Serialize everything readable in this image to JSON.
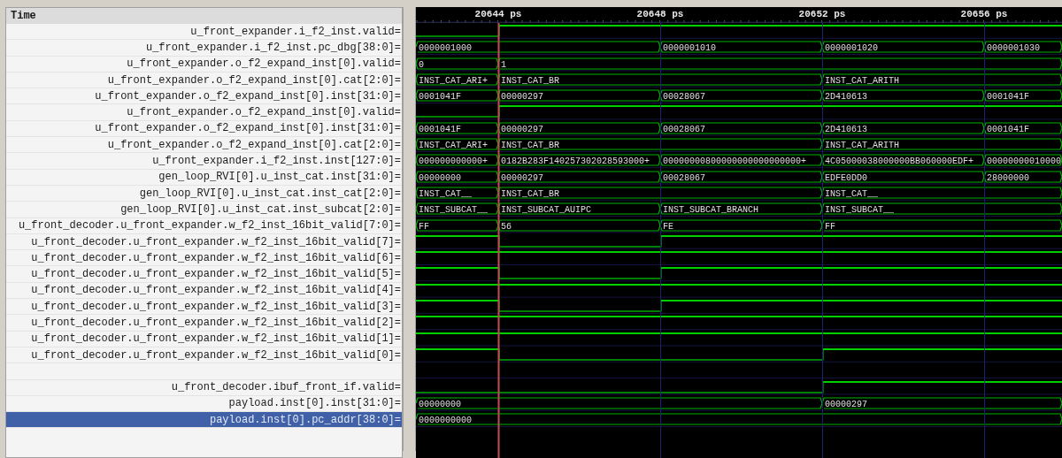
{
  "time_header": "Time",
  "ticks": [
    {
      "label": "20644 ps",
      "cursor": true
    },
    {
      "label": "20648 ps",
      "cursor": false
    },
    {
      "label": "20652 ps",
      "cursor": false
    },
    {
      "label": "20656 ps",
      "cursor": false
    }
  ],
  "signals": [
    {
      "name": "u_front_expander.i_f2_inst.valid=",
      "selected": false,
      "kind": "bit",
      "high": [
        false,
        true,
        true,
        true,
        true
      ]
    },
    {
      "name": "u_front_expander.i_f2_inst.pc_dbg[38:0]=",
      "selected": false,
      "kind": "bus",
      "intervals": [
        {
          "value": "0000001000",
          "hold": false
        },
        {
          "hold": true
        },
        {
          "value": "0000001010",
          "hold": false
        },
        {
          "value": "0000001020",
          "hold": false
        },
        {
          "value": "0000001030",
          "hold": false
        }
      ]
    },
    {
      "name": "u_front_expander.o_f2_expand_inst[0].valid=",
      "selected": false,
      "kind": "bus",
      "intervals": [
        {
          "value": "0",
          "hold": false
        },
        {
          "value": "1",
          "hold": false
        },
        {
          "hold": true
        },
        {
          "hold": true
        },
        {
          "hold": true
        }
      ]
    },
    {
      "name": "u_front_expander.o_f2_expand_inst[0].cat[2:0]=",
      "selected": false,
      "kind": "bus",
      "intervals": [
        {
          "value": "INST_CAT_ARI+",
          "hold": false
        },
        {
          "value": "INST_CAT_BR",
          "hold": false
        },
        {
          "hold": true
        },
        {
          "value": "INST_CAT_ARITH",
          "hold": false
        },
        {
          "hold": true
        }
      ]
    },
    {
      "name": "u_front_expander.o_f2_expand_inst[0].inst[31:0]=",
      "selected": false,
      "kind": "bus",
      "intervals": [
        {
          "value": "0001041F",
          "hold": false
        },
        {
          "value": "00000297",
          "hold": false
        },
        {
          "value": "00028067",
          "hold": false
        },
        {
          "value": "2D410613",
          "hold": false
        },
        {
          "value": "0001041F",
          "hold": false
        }
      ]
    },
    {
      "name": "u_front_expander.o_f2_expand_inst[0].valid=",
      "selected": false,
      "kind": "bit",
      "high": [
        false,
        true,
        true,
        true,
        true
      ]
    },
    {
      "name": "u_front_expander.o_f2_expand_inst[0].inst[31:0]=",
      "selected": false,
      "kind": "bus",
      "intervals": [
        {
          "value": "0001041F",
          "hold": false
        },
        {
          "value": "00000297",
          "hold": false
        },
        {
          "value": "00028067",
          "hold": false
        },
        {
          "value": "2D410613",
          "hold": false
        },
        {
          "value": "0001041F",
          "hold": false
        }
      ]
    },
    {
      "name": "u_front_expander.o_f2_expand_inst[0].cat[2:0]=",
      "selected": false,
      "kind": "bus",
      "intervals": [
        {
          "value": "INST_CAT_ARI+",
          "hold": false
        },
        {
          "value": "INST_CAT_BR",
          "hold": false
        },
        {
          "hold": true
        },
        {
          "value": "INST_CAT_ARITH",
          "hold": false
        },
        {
          "hold": true
        }
      ]
    },
    {
      "name": "u_front_expander.i_f2_inst.inst[127:0]=",
      "selected": false,
      "kind": "bus",
      "intervals": [
        {
          "value": "000000000000+",
          "hold": false
        },
        {
          "value": "0182B283F140257302028593000+",
          "hold": false
        },
        {
          "value": "00000000800000000000000000+",
          "hold": false
        },
        {
          "value": "4C05000038000000BB060000EDF+",
          "hold": false
        },
        {
          "value": "00000000010000",
          "hold": false
        }
      ]
    },
    {
      "name": "gen_loop_RVI[0].u_inst_cat.inst[31:0]=",
      "selected": false,
      "kind": "bus",
      "intervals": [
        {
          "value": "00000000",
          "hold": false
        },
        {
          "value": "00000297",
          "hold": false
        },
        {
          "value": "00028067",
          "hold": false
        },
        {
          "value": "EDFE0DD0",
          "hold": false
        },
        {
          "value": "28000000",
          "hold": false
        }
      ]
    },
    {
      "name": "gen_loop_RVI[0].u_inst_cat.inst_cat[2:0]=",
      "selected": false,
      "kind": "bus",
      "intervals": [
        {
          "value": "INST_CAT__",
          "hold": false
        },
        {
          "value": "INST_CAT_BR",
          "hold": false
        },
        {
          "hold": true
        },
        {
          "value": "INST_CAT__",
          "hold": false
        },
        {
          "hold": true
        }
      ]
    },
    {
      "name": "gen_loop_RVI[0].u_inst_cat.inst_subcat[2:0]=",
      "selected": false,
      "kind": "bus",
      "intervals": [
        {
          "value": "INST_SUBCAT__",
          "hold": false
        },
        {
          "value": "INST_SUBCAT_AUIPC",
          "hold": false
        },
        {
          "value": "INST_SUBCAT_BRANCH",
          "hold": false
        },
        {
          "value": "INST_SUBCAT__",
          "hold": false
        },
        {
          "hold": true
        }
      ]
    },
    {
      "name": "u_front_decoder.u_front_expander.w_f2_inst_16bit_valid[7:0]=",
      "selected": false,
      "kind": "bus",
      "intervals": [
        {
          "value": "FF",
          "hold": false
        },
        {
          "value": "56",
          "hold": false
        },
        {
          "value": "FE",
          "hold": false
        },
        {
          "value": "FF",
          "hold": false
        },
        {
          "hold": true
        }
      ]
    },
    {
      "name": "u_front_decoder.u_front_expander.w_f2_inst_16bit_valid[7]=",
      "selected": false,
      "kind": "bit",
      "high": [
        true,
        false,
        true,
        true,
        true
      ]
    },
    {
      "name": "u_front_decoder.u_front_expander.w_f2_inst_16bit_valid[6]=",
      "selected": false,
      "kind": "bit",
      "high": [
        true,
        true,
        true,
        true,
        true
      ]
    },
    {
      "name": "u_front_decoder.u_front_expander.w_f2_inst_16bit_valid[5]=",
      "selected": false,
      "kind": "bit",
      "high": [
        true,
        false,
        true,
        true,
        true
      ]
    },
    {
      "name": "u_front_decoder.u_front_expander.w_f2_inst_16bit_valid[4]=",
      "selected": false,
      "kind": "bit",
      "high": [
        true,
        true,
        true,
        true,
        true
      ]
    },
    {
      "name": "u_front_decoder.u_front_expander.w_f2_inst_16bit_valid[3]=",
      "selected": false,
      "kind": "bit",
      "high": [
        true,
        false,
        true,
        true,
        true
      ]
    },
    {
      "name": "u_front_decoder.u_front_expander.w_f2_inst_16bit_valid[2]=",
      "selected": false,
      "kind": "bit",
      "high": [
        true,
        true,
        true,
        true,
        true
      ]
    },
    {
      "name": "u_front_decoder.u_front_expander.w_f2_inst_16bit_valid[1]=",
      "selected": false,
      "kind": "bit",
      "high": [
        true,
        true,
        true,
        true,
        true
      ]
    },
    {
      "name": "u_front_decoder.u_front_expander.w_f2_inst_16bit_valid[0]=",
      "selected": false,
      "kind": "bit",
      "high": [
        true,
        false,
        false,
        true,
        true
      ]
    },
    {
      "selected": false,
      "kind": "blank"
    },
    {
      "name": "u_front_decoder.ibuf_front_if.valid=",
      "selected": false,
      "kind": "bit",
      "high": [
        false,
        false,
        false,
        true,
        true
      ]
    },
    {
      "name": "payload.inst[0].inst[31:0]=",
      "selected": false,
      "kind": "bus",
      "intervals": [
        {
          "value": "00000000",
          "hold": false
        },
        {
          "hold": true
        },
        {
          "hold": true
        },
        {
          "value": "00000297",
          "hold": false
        },
        {
          "hold": true
        }
      ]
    },
    {
      "name": "payload.inst[0].pc_addr[38:0]=",
      "selected": true,
      "kind": "bus",
      "intervals": [
        {
          "value": "0000000000",
          "hold": false
        },
        {
          "hold": true
        },
        {
          "hold": true
        },
        {
          "hold": true
        },
        {
          "hold": true
        }
      ]
    }
  ]
}
